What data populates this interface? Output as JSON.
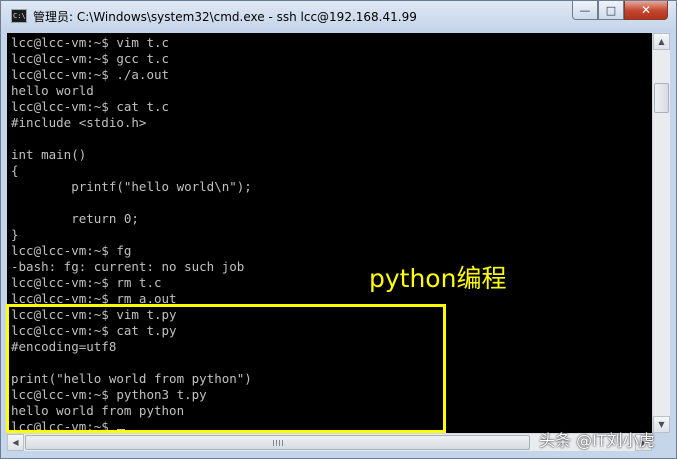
{
  "window": {
    "title": "管理员: C:\\Windows\\system32\\cmd.exe - ssh  lcc@192.168.41.99",
    "app_icon_text": "C:\\",
    "minimize_glyph": "—",
    "maximize_glyph": "□",
    "close_glyph": "✕"
  },
  "terminal": {
    "lines": [
      "lcc@lcc-vm:~$ vim t.c",
      "lcc@lcc-vm:~$ gcc t.c",
      "lcc@lcc-vm:~$ ./a.out",
      "hello world",
      "lcc@lcc-vm:~$ cat t.c",
      "#include <stdio.h>",
      "",
      "int main()",
      "{",
      "        printf(\"hello world\\n\");",
      "",
      "        return 0;",
      "}",
      "lcc@lcc-vm:~$ fg",
      "-bash: fg: current: no such job",
      "lcc@lcc-vm:~$ rm t.c",
      "lcc@lcc-vm:~$ rm a.out",
      "lcc@lcc-vm:~$ vim t.py",
      "lcc@lcc-vm:~$ cat t.py",
      "#encoding=utf8",
      "",
      "print(\"hello world from python\")",
      "lcc@lcc-vm:~$ python3 t.py",
      "hello world from python",
      "lcc@lcc-vm:~$ "
    ]
  },
  "scrollbar": {
    "up_glyph": "▲",
    "down_glyph": "▼",
    "left_glyph": "◀",
    "right_glyph": "▶"
  },
  "annotation": {
    "label": "python编程",
    "color": "#ffff00"
  },
  "watermark": {
    "text": "头条 @IT刘小虎"
  },
  "colors": {
    "terminal_bg": "#000000",
    "terminal_fg": "#c0c0c0",
    "highlight": "#ffff00",
    "close_button": "#c2452d"
  }
}
